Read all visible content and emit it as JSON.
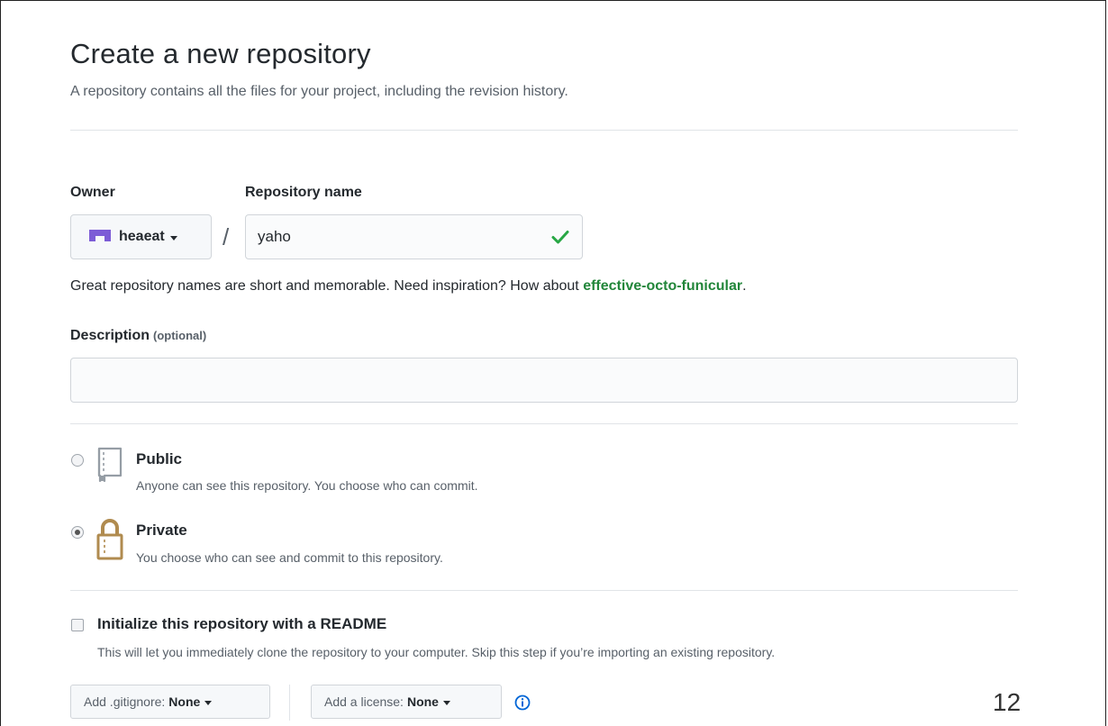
{
  "header": {
    "title": "Create a new repository",
    "subtitle": "A repository contains all the files for your project, including the revision history."
  },
  "owner": {
    "label": "Owner",
    "name": "heaeat"
  },
  "repository": {
    "label": "Repository name",
    "value": "yaho",
    "separator": "/"
  },
  "hint": {
    "text": "Great repository names are short and memorable. Need inspiration? How about ",
    "suggestion": "effective-octo-funicular",
    "end": "."
  },
  "description": {
    "label": "Description",
    "optional": "(optional)",
    "value": ""
  },
  "visibility": {
    "public": {
      "title": "Public",
      "desc": "Anyone can see this repository. You choose who can commit.",
      "selected": false
    },
    "private": {
      "title": "Private",
      "desc": "You choose who can see and commit to this repository.",
      "selected": true
    }
  },
  "readme": {
    "title": "Initialize this repository with a README",
    "desc": "This will let you immediately clone the repository to your computer. Skip this step if you’re importing an existing repository.",
    "checked": false
  },
  "gitignore": {
    "label": "Add .gitignore:",
    "value": "None"
  },
  "license": {
    "label": "Add a license:",
    "value": "None"
  },
  "page_number": "12",
  "colors": {
    "accent_green": "#22863a",
    "check_green": "#28a745",
    "owner_avatar": "#7c5cd6",
    "info_blue": "#0366d6",
    "repo_icon_gray": "#959da5",
    "lock_icon_gold": "#b08b4f"
  }
}
